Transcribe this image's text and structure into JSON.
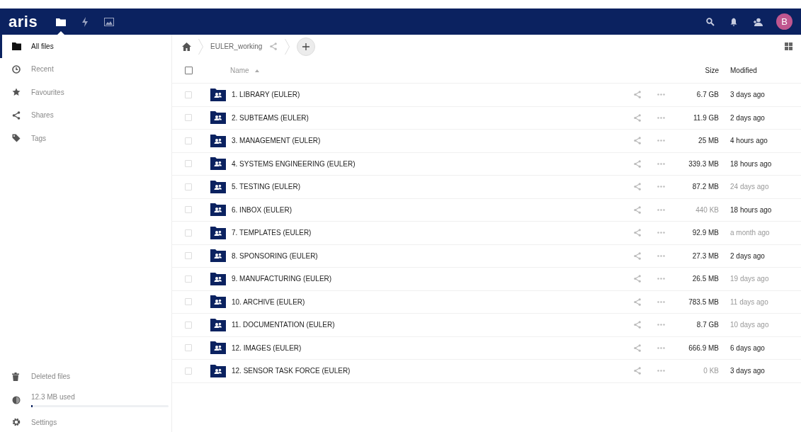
{
  "header": {
    "logo": "aris",
    "apps": [
      {
        "kind": "files",
        "selected": true
      },
      {
        "kind": "activity",
        "selected": false
      },
      {
        "kind": "gallery",
        "selected": false
      }
    ],
    "avatar": "B"
  },
  "sidebar": {
    "items": [
      {
        "kind": "folder",
        "label": "All files",
        "selected": true
      },
      {
        "kind": "clock",
        "label": "Recent",
        "selected": false
      },
      {
        "kind": "star",
        "label": "Favourites",
        "selected": false
      },
      {
        "kind": "share",
        "label": "Shares",
        "selected": false
      },
      {
        "kind": "tag",
        "label": "Tags",
        "selected": false
      }
    ],
    "deleted": "Deleted files",
    "quota": {
      "label": "12.3 MB used",
      "level": 0.01
    },
    "settings": "Settings"
  },
  "breadcrumb": {
    "folder": "EULER_working"
  },
  "table": {
    "select_all_checked": false,
    "columns": {
      "name": "Name",
      "size": "Size",
      "modified": "Modified"
    },
    "rows": [
      {
        "checked": false,
        "name": "1. LIBRARY (EULER)",
        "size": "6.7 GB",
        "size_faded": false,
        "modified": "3 days ago",
        "modified_faded": false
      },
      {
        "checked": false,
        "name": "2. SUBTEAMS (EULER)",
        "size": "11.9 GB",
        "size_faded": false,
        "modified": "2 days ago",
        "modified_faded": false
      },
      {
        "checked": false,
        "name": "3. MANAGEMENT (EULER)",
        "size": "25 MB",
        "size_faded": false,
        "modified": "4 hours ago",
        "modified_faded": false
      },
      {
        "checked": false,
        "name": "4. SYSTEMS ENGINEERING (EULER)",
        "size": "339.3 MB",
        "size_faded": false,
        "modified": "18 hours ago",
        "modified_faded": false
      },
      {
        "checked": false,
        "name": "5. TESTING (EULER)",
        "size": "87.2 MB",
        "size_faded": false,
        "modified": "24 days ago",
        "modified_faded": true
      },
      {
        "checked": false,
        "name": "6. INBOX (EULER)",
        "size": "440 KB",
        "size_faded": true,
        "modified": "18 hours ago",
        "modified_faded": false
      },
      {
        "checked": false,
        "name": "7. TEMPLATES (EULER)",
        "size": "92.9 MB",
        "size_faded": false,
        "modified": "a month ago",
        "modified_faded": true
      },
      {
        "checked": false,
        "name": "8. SPONSORING (EULER)",
        "size": "27.3 MB",
        "size_faded": false,
        "modified": "2 days ago",
        "modified_faded": false
      },
      {
        "checked": false,
        "name": "9. MANUFACTURING (EULER)",
        "size": "26.5 MB",
        "size_faded": false,
        "modified": "19 days ago",
        "modified_faded": true
      },
      {
        "checked": false,
        "name": "10. ARCHIVE (EULER)",
        "size": "783.5 MB",
        "size_faded": false,
        "modified": "11 days ago",
        "modified_faded": true
      },
      {
        "checked": false,
        "name": "11. DOCUMENTATION (EULER)",
        "size": "8.7 GB",
        "size_faded": false,
        "modified": "10 days ago",
        "modified_faded": true
      },
      {
        "checked": false,
        "name": "12. IMAGES (EULER)",
        "size": "666.9 MB",
        "size_faded": false,
        "modified": "6 days ago",
        "modified_faded": false
      },
      {
        "checked": false,
        "name": "12. SENSOR TASK FORCE (EULER)",
        "size": "0 KB",
        "size_faded": true,
        "modified": "3 days ago",
        "modified_faded": false
      }
    ]
  }
}
